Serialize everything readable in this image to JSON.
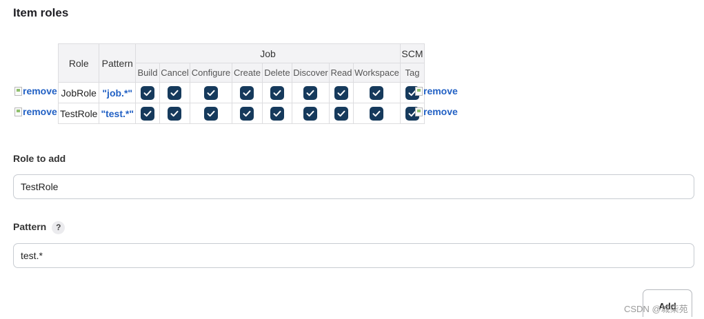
{
  "section": {
    "title": "Item roles"
  },
  "table": {
    "role_header": "Role",
    "pattern_header": "Pattern",
    "groups": [
      {
        "name": "Job",
        "span": 8
      },
      {
        "name": "SCM",
        "span": 1
      }
    ],
    "permissions": [
      "Build",
      "Cancel",
      "Configure",
      "Create",
      "Delete",
      "Discover",
      "Read",
      "Workspace",
      "Tag"
    ],
    "rows": [
      {
        "role": "JobRole",
        "pattern": "\"job.*\"",
        "checked": [
          true,
          true,
          true,
          true,
          true,
          true,
          true,
          true,
          true
        ]
      },
      {
        "role": "TestRole",
        "pattern": "\"test.*\"",
        "checked": [
          true,
          true,
          true,
          true,
          true,
          true,
          true,
          true,
          true
        ]
      }
    ],
    "remove_alt": "remove"
  },
  "form": {
    "role_label": "Role to add",
    "role_value": "TestRole",
    "pattern_label": "Pattern",
    "help_symbol": "?",
    "pattern_value": "test.*",
    "add_label": "Add"
  },
  "watermark": "CSDN @城柒苑",
  "colors": {
    "checkbox": "#163a5c",
    "link": "#2160c4"
  }
}
